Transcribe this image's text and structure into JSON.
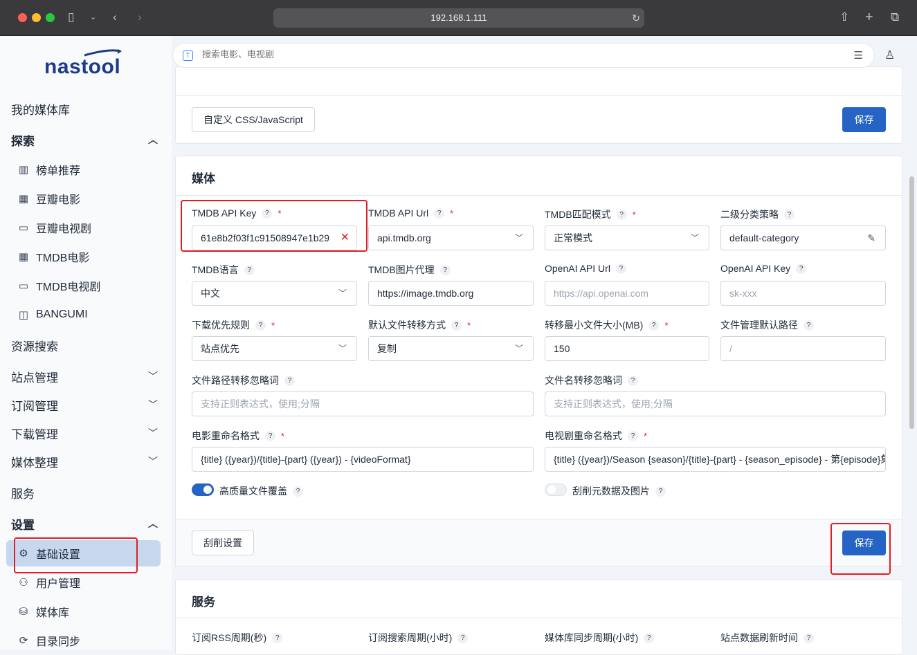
{
  "browser": {
    "url": "192.168.1.111"
  },
  "app": {
    "logo": "nastool"
  },
  "search": {
    "placeholder": "搜索电影、电视剧",
    "icon": "T"
  },
  "sidebar": {
    "my_library": "我的媒体库",
    "explore": "探索",
    "explore_items": [
      "榜单推荐",
      "豆瓣电影",
      "豆瓣电视剧",
      "TMDB电影",
      "TMDB电视剧",
      "BANGUMI"
    ],
    "resource_search": "资源搜索",
    "site_mgmt": "站点管理",
    "subscribe_mgmt": "订阅管理",
    "download_mgmt": "下载管理",
    "media_org": "媒体整理",
    "services": "服务",
    "settings": "设置",
    "settings_items": [
      "基础设置",
      "用户管理",
      "媒体库",
      "目录同步"
    ]
  },
  "top_card": {
    "custom_button": "自定义 CSS/JavaScript",
    "save": "保存"
  },
  "media": {
    "title": "媒体",
    "labels": {
      "tmdb_key": "TMDB API Key",
      "tmdb_url": "TMDB API Url",
      "tmdb_match": "TMDB匹配模式",
      "category": "二级分类策略",
      "tmdb_lang": "TMDB语言",
      "tmdb_img": "TMDB图片代理",
      "openai_url": "OpenAI API Url",
      "openai_key": "OpenAI API Key",
      "dl_rule": "下载优先规则",
      "transfer_mode": "默认文件转移方式",
      "min_size": "转移最小文件大小(MB)",
      "file_path": "文件管理默认路径",
      "path_ignore": "文件路径转移忽略词",
      "name_ignore": "文件名转移忽略词",
      "movie_fmt": "电影重命名格式",
      "tv_fmt": "电视剧重命名格式",
      "hq_overwrite": "高质量文件覆盖",
      "scrape": "刮削元数据及图片"
    },
    "values": {
      "tmdb_key": "61e8b2f03f1c91508947e1b29",
      "tmdb_url": "api.tmdb.org",
      "tmdb_match": "正常模式",
      "category": "default-category",
      "tmdb_lang": "中文",
      "tmdb_img": "https://image.tmdb.org",
      "dl_rule": "站点优先",
      "transfer_mode": "复制",
      "min_size": "150",
      "movie_fmt": "{title} ({year})/{title}-{part} ({year}) - {videoFormat}",
      "tv_fmt": "{title} ({year})/Season {season}/{title}-{part} - {season_episode} - 第{episode}集"
    },
    "placeholders": {
      "openai_url": "https://api.openai.com",
      "openai_key": "sk-xxx",
      "file_path": "/",
      "path_ignore": "支持正则表达式，使用;分隔",
      "name_ignore": "支持正则表达式，使用;分隔"
    },
    "toggles": {
      "hq_overwrite": true,
      "scrape": false
    },
    "footer": {
      "scrape_settings": "刮削设置",
      "save": "保存"
    }
  },
  "services_card": {
    "title": "服务",
    "labels": [
      "订阅RSS周期(秒)",
      "订阅搜索周期(小时)",
      "媒体库同步周期(小时)",
      "站点数据刷新时间"
    ]
  },
  "help_glyph": "?",
  "required_glyph": "*"
}
